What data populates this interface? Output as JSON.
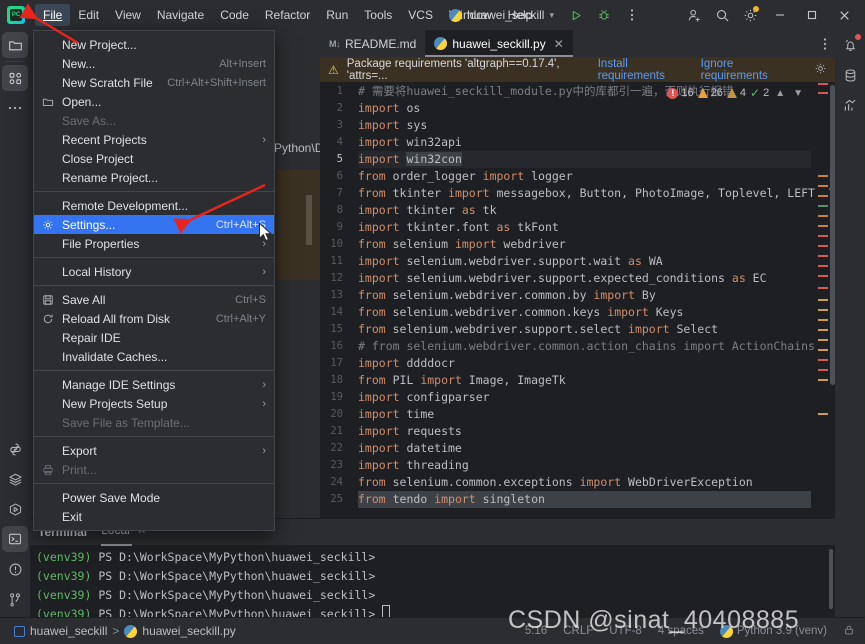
{
  "app": {
    "logo_label": "PC",
    "project_name": "huawei_seckill"
  },
  "menubar": {
    "items": [
      {
        "label": "File",
        "active": true
      },
      {
        "label": "Edit",
        "active": false
      },
      {
        "label": "View",
        "active": false
      },
      {
        "label": "Navigate",
        "active": false
      },
      {
        "label": "Code",
        "active": false
      },
      {
        "label": "Refactor",
        "active": false
      },
      {
        "label": "Run",
        "active": false
      },
      {
        "label": "Tools",
        "active": false
      },
      {
        "label": "VCS",
        "active": false
      },
      {
        "label": "Window",
        "active": false
      },
      {
        "label": "Help",
        "active": false
      }
    ]
  },
  "titlebar_icons": {
    "run": "run-icon",
    "debug": "debug-icon",
    "more": "more-vertical-icon",
    "account": "add-account-icon",
    "search": "search-icon",
    "settings": "gear-icon",
    "minimize": "minimize-icon",
    "maximize": "maximize-icon",
    "close": "close-icon"
  },
  "file_menu": {
    "groups": [
      [
        {
          "label": "New Project...",
          "accel": "",
          "icon": "",
          "arrow": false,
          "disabled": false,
          "selected": false
        },
        {
          "label": "New...",
          "accel": "Alt+Insert",
          "icon": "",
          "arrow": false,
          "disabled": false,
          "selected": false
        },
        {
          "label": "New Scratch File",
          "accel": "Ctrl+Alt+Shift+Insert",
          "icon": "",
          "arrow": false,
          "disabled": false,
          "selected": false
        },
        {
          "label": "Open...",
          "accel": "",
          "icon": "folder-icon",
          "arrow": false,
          "disabled": false,
          "selected": false
        },
        {
          "label": "Save As...",
          "accel": "",
          "icon": "",
          "arrow": false,
          "disabled": true,
          "selected": false
        },
        {
          "label": "Recent Projects",
          "accel": "",
          "icon": "",
          "arrow": true,
          "disabled": false,
          "selected": false
        },
        {
          "label": "Close Project",
          "accel": "",
          "icon": "",
          "arrow": false,
          "disabled": false,
          "selected": false
        },
        {
          "label": "Rename Project...",
          "accel": "",
          "icon": "",
          "arrow": false,
          "disabled": false,
          "selected": false
        }
      ],
      [
        {
          "label": "Remote Development...",
          "accel": "",
          "icon": "",
          "arrow": false,
          "disabled": false,
          "selected": false
        },
        {
          "label": "Settings...",
          "accel": "Ctrl+Alt+S",
          "icon": "gear-icon",
          "arrow": false,
          "disabled": false,
          "selected": true
        },
        {
          "label": "File Properties",
          "accel": "",
          "icon": "",
          "arrow": true,
          "disabled": false,
          "selected": false
        }
      ],
      [
        {
          "label": "Local History",
          "accel": "",
          "icon": "",
          "arrow": true,
          "disabled": false,
          "selected": false
        }
      ],
      [
        {
          "label": "Save All",
          "accel": "Ctrl+S",
          "icon": "save-icon",
          "arrow": false,
          "disabled": false,
          "selected": false
        },
        {
          "label": "Reload All from Disk",
          "accel": "Ctrl+Alt+Y",
          "icon": "reload-icon",
          "arrow": false,
          "disabled": false,
          "selected": false
        },
        {
          "label": "Repair IDE",
          "accel": "",
          "icon": "",
          "arrow": false,
          "disabled": false,
          "selected": false
        },
        {
          "label": "Invalidate Caches...",
          "accel": "",
          "icon": "",
          "arrow": false,
          "disabled": false,
          "selected": false
        }
      ],
      [
        {
          "label": "Manage IDE Settings",
          "accel": "",
          "icon": "",
          "arrow": true,
          "disabled": false,
          "selected": false
        },
        {
          "label": "New Projects Setup",
          "accel": "",
          "icon": "",
          "arrow": true,
          "disabled": false,
          "selected": false
        },
        {
          "label": "Save File as Template...",
          "accel": "",
          "icon": "",
          "arrow": false,
          "disabled": true,
          "selected": false
        }
      ],
      [
        {
          "label": "Export",
          "accel": "",
          "icon": "",
          "arrow": true,
          "disabled": false,
          "selected": false
        },
        {
          "label": "Print...",
          "accel": "",
          "icon": "print-icon",
          "arrow": false,
          "disabled": true,
          "selected": false
        }
      ],
      [
        {
          "label": "Power Save Mode",
          "accel": "",
          "icon": "",
          "arrow": false,
          "disabled": false,
          "selected": false
        },
        {
          "label": "Exit",
          "accel": "",
          "icon": "",
          "arrow": false,
          "disabled": false,
          "selected": false
        }
      ]
    ]
  },
  "project_panel": {
    "partial_path_label": "Python\\Dis"
  },
  "left_rail": {
    "top": [
      {
        "name": "project-icon",
        "selected": true
      },
      {
        "name": "structure-icon",
        "selected": true
      },
      {
        "name": "more-tool-windows-icon",
        "selected": false
      }
    ],
    "bottom": [
      {
        "name": "python-packages-icon",
        "selected": false
      },
      {
        "name": "database-layers-icon",
        "selected": false
      },
      {
        "name": "services-icon",
        "selected": false
      },
      {
        "name": "terminal-icon",
        "selected": true
      },
      {
        "name": "problems-icon",
        "selected": false
      },
      {
        "name": "version-control-icon",
        "selected": false
      }
    ]
  },
  "right_rail": {
    "items": [
      {
        "name": "notifications-icon"
      },
      {
        "name": "database-icon"
      },
      {
        "name": "profiler-icon"
      }
    ]
  },
  "editor": {
    "tabs": [
      {
        "label": "README.md",
        "icon": "markdown-icon",
        "active": false,
        "closable": false
      },
      {
        "label": "huawei_seckill.py",
        "icon": "python-icon",
        "active": true,
        "closable": true
      }
    ],
    "notification": {
      "icon": "warning-icon",
      "text": "Package requirements 'altgraph==0.17.4', 'attrs=...",
      "action_primary": "Install requirements",
      "action_secondary": "Ignore requirements",
      "settings_icon": "gear-icon"
    },
    "inspections": {
      "errors": "16",
      "warnings": "26",
      "weak_warnings": "4",
      "typos": "2",
      "prev_icon": "chevron-up-icon",
      "next_icon": "chevron-down-icon"
    },
    "current_line": 5,
    "lines": [
      {
        "n": 1,
        "text": "# 需要将huawei_seckill_module.py中的库都引一遍，否则执行报错",
        "kind": "comment"
      },
      {
        "n": 2,
        "text": "import os",
        "kind": "code"
      },
      {
        "n": 3,
        "text": "import sys",
        "kind": "code"
      },
      {
        "n": 4,
        "text": "import win32api",
        "kind": "code"
      },
      {
        "n": 5,
        "text": "import win32con",
        "kind": "code"
      },
      {
        "n": 6,
        "text": "from order_logger import logger",
        "kind": "code"
      },
      {
        "n": 7,
        "text": "from tkinter import messagebox, Button, PhotoImage, Toplevel, LEFT, TOP, BOTT",
        "kind": "code"
      },
      {
        "n": 8,
        "text": "import tkinter as tk",
        "kind": "code"
      },
      {
        "n": 9,
        "text": "import tkinter.font as tkFont",
        "kind": "code"
      },
      {
        "n": 10,
        "text": "from selenium import webdriver",
        "kind": "code"
      },
      {
        "n": 11,
        "text": "import selenium.webdriver.support.wait as WA",
        "kind": "code"
      },
      {
        "n": 12,
        "text": "import selenium.webdriver.support.expected_conditions as EC",
        "kind": "code"
      },
      {
        "n": 13,
        "text": "from selenium.webdriver.common.by import By",
        "kind": "code"
      },
      {
        "n": 14,
        "text": "from selenium.webdriver.common.keys import Keys",
        "kind": "code"
      },
      {
        "n": 15,
        "text": "from selenium.webdriver.support.select import Select",
        "kind": "code"
      },
      {
        "n": 16,
        "text": "# from selenium.webdriver.common.action_chains import ActionChains",
        "kind": "comment"
      },
      {
        "n": 17,
        "text": "import ddddocr",
        "kind": "code"
      },
      {
        "n": 18,
        "text": "from PIL import Image, ImageTk",
        "kind": "code"
      },
      {
        "n": 19,
        "text": "import configparser",
        "kind": "code"
      },
      {
        "n": 20,
        "text": "import time",
        "kind": "code"
      },
      {
        "n": 21,
        "text": "import requests",
        "kind": "code"
      },
      {
        "n": 22,
        "text": "import datetime",
        "kind": "code"
      },
      {
        "n": 23,
        "text": "import threading",
        "kind": "code"
      },
      {
        "n": 24,
        "text": "from selenium.common.exceptions import WebDriverException",
        "kind": "code"
      },
      {
        "n": 25,
        "text": "from tendo import singleton",
        "kind": "code"
      }
    ]
  },
  "terminal": {
    "title": "Terminal",
    "tab": "Local",
    "close_icon": "close-icon",
    "prompt_env": "(venv39)",
    "prompt_body": " PS D:\\WorkSpace\\MyPython\\huawei_seckill>",
    "line_count": 4
  },
  "status_bar": {
    "breadcrumb_project": "huawei_seckill",
    "breadcrumb_sep": ">",
    "breadcrumb_file": "huawei_seckill.py",
    "caret": "5:16",
    "line_sep": "CRLF",
    "encoding": "UTF-8",
    "indent": "4 spaces",
    "interpreter": "Python 3.9 (venv)",
    "lock_icon": "lock-icon"
  },
  "watermark": {
    "text": "CSDN @sinat_40408885"
  },
  "colors": {
    "accent_blue": "#3574f0",
    "link_blue": "#5a9bf6",
    "warning_amber": "#f2c55c",
    "error_red": "#e05555",
    "ok_green": "#5fb865",
    "bg_chrome": "#2b2d30",
    "bg_editor": "#1e1f22",
    "notif_bg": "#3b3122",
    "arrow_red": "#e8241c"
  }
}
